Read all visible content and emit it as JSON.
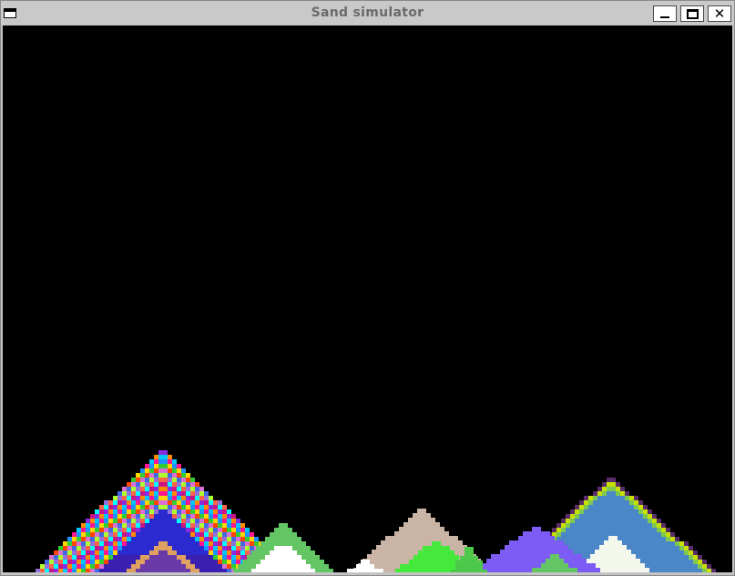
{
  "window": {
    "title": "Sand simulator",
    "controls": {
      "menu_icon": "window-menu-icon",
      "minimize_icon": "minimize-icon",
      "maximize_icon": "maximize-icon",
      "close_icon": "close-icon",
      "close_glyph": "✕"
    }
  },
  "canvas": {
    "background": "#000000",
    "piles": [
      {
        "name": "rainbow-pile",
        "colors": [
          "#8a2be2",
          "#ff8c00",
          "#00c8ff",
          "#ff1493",
          "#1e90ff",
          "#ffd700",
          "#32cd32",
          "#ff4500",
          "#da70d6",
          "#4169e1",
          "#adff2f",
          "#9370db",
          "#ff6347",
          "#00ffff",
          "#c71585"
        ]
      },
      {
        "name": "green-white-pile",
        "colors": [
          "#63c563",
          "#ffffff"
        ]
      },
      {
        "name": "tan-pile",
        "colors": [
          "#c9b4a6"
        ]
      },
      {
        "name": "lime-pile",
        "colors": [
          "#44e93c"
        ]
      },
      {
        "name": "violet-pile",
        "colors": [
          "#7d5cf5"
        ]
      },
      {
        "name": "blue-striped-pile",
        "colors": [
          "#5a2d6a",
          "#c8e000",
          "#4a86c8",
          "#f3f7e8"
        ]
      }
    ]
  }
}
